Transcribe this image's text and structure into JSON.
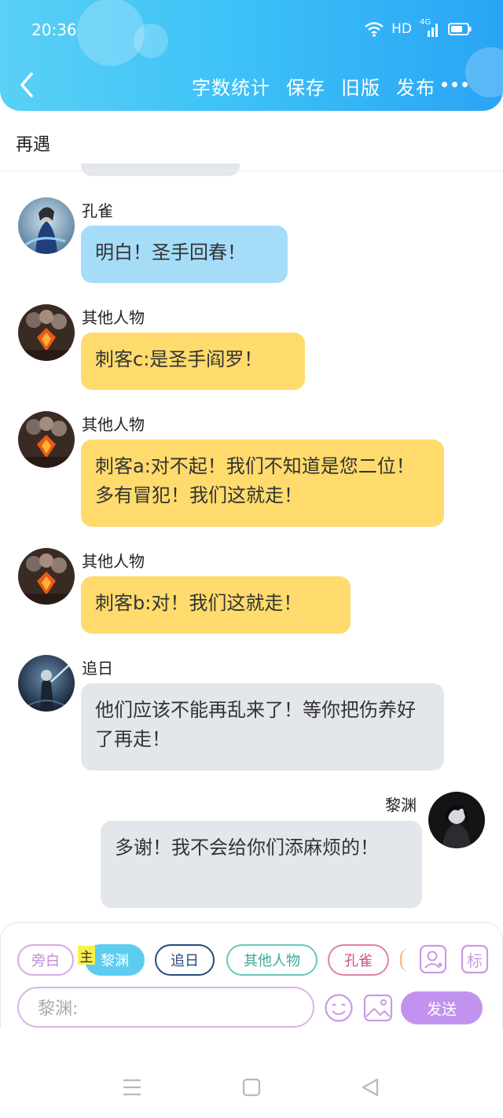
{
  "status": {
    "time": "20:36",
    "hd": "HD",
    "network": "4G"
  },
  "header": {
    "toolbar": [
      "字数统计",
      "保存",
      "旧版",
      "发布"
    ]
  },
  "chapter": {
    "title": "再遇"
  },
  "messages": [
    {
      "sender": "孔雀",
      "text": "明白！圣手回春！",
      "side": "left",
      "color": "#a5ddf9"
    },
    {
      "sender": "其他人物",
      "text": "刺客c:是圣手阎罗！",
      "side": "left",
      "color": "#fedb6c"
    },
    {
      "sender": "其他人物",
      "text": "刺客a:对不起！我们不知道是您二位！多有冒犯！我们这就走！",
      "side": "left",
      "color": "#fedb6c"
    },
    {
      "sender": "其他人物",
      "text": "刺客b:对！我们这就走！",
      "side": "left",
      "color": "#fedb6c"
    },
    {
      "sender": "追日",
      "text": "他们应该不能再乱来了！等你把伤养好了再走！",
      "side": "left",
      "color": "#e3e6eb"
    },
    {
      "sender": "黎渊",
      "text": "多谢！我不会给你们添麻烦的！",
      "side": "right",
      "color": "#e3e6eb"
    }
  ],
  "roles": [
    {
      "label": "旁白",
      "color": "#d9a8e6"
    },
    {
      "label": "黎渊",
      "host_tag": "主",
      "color": "#5ccdf0"
    },
    {
      "label": "追日",
      "color": "#244b7e"
    },
    {
      "label": "其他人物",
      "color": "#67c7b8"
    },
    {
      "label": "孔雀",
      "color": "#e080aa"
    }
  ],
  "composer": {
    "placeholder": "黎渊:",
    "send_label": "发送",
    "tag_label": "标"
  }
}
